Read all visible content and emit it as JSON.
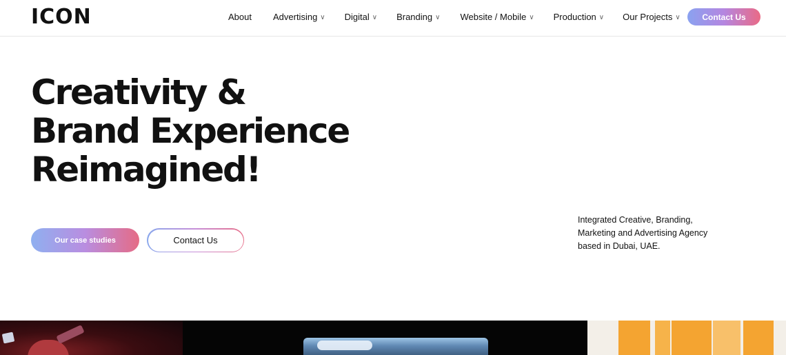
{
  "header": {
    "logo_text": "ICON",
    "nav": [
      {
        "label": "About",
        "has_dropdown": false
      },
      {
        "label": "Advertising",
        "has_dropdown": true
      },
      {
        "label": "Digital",
        "has_dropdown": true
      },
      {
        "label": "Branding",
        "has_dropdown": true
      },
      {
        "label": "Website / Mobile",
        "has_dropdown": true
      },
      {
        "label": "Production",
        "has_dropdown": true
      },
      {
        "label": "Our Projects",
        "has_dropdown": true
      }
    ],
    "chevron_glyph": "∨",
    "contact_label": "Contact Us"
  },
  "hero": {
    "title_lines": [
      "Creativity &",
      "Brand Experience",
      "Reimagined!"
    ],
    "primary_button": "Our case studies",
    "secondary_button": "Contact Us",
    "tagline_lines": [
      "Integrated Creative, Branding,",
      "Marketing and Advertising Agency",
      "based in Dubai, UAE."
    ]
  },
  "colors": {
    "gradient_start": "#8aa2f0",
    "gradient_mid": "#b486e0",
    "gradient_end": "#ea6a86",
    "text": "#111111",
    "background": "#ffffff"
  },
  "icons": {
    "dropdown": "chevron-down-icon"
  }
}
